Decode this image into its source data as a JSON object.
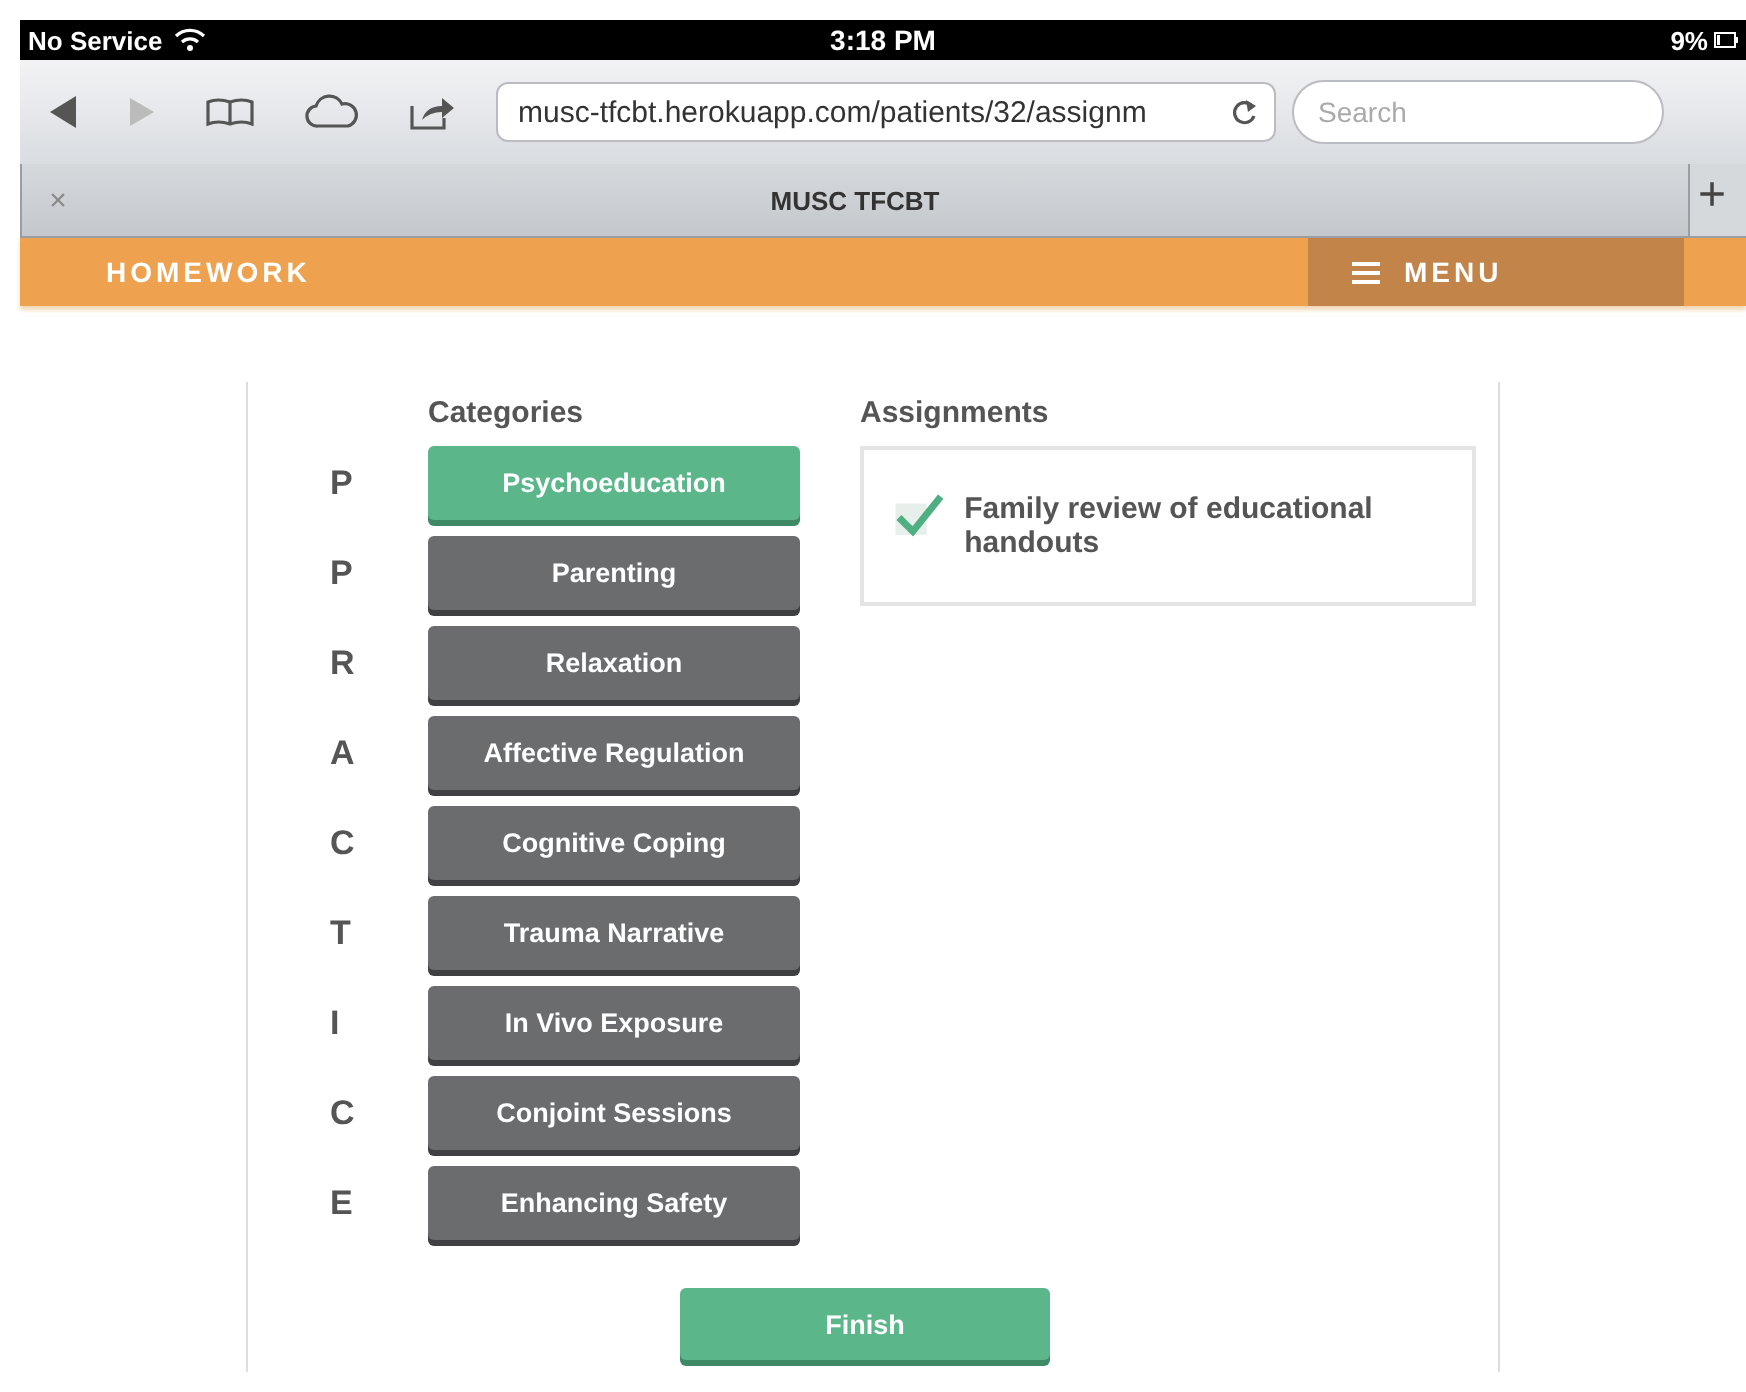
{
  "status_bar": {
    "carrier": "No Service",
    "time": "3:18 PM",
    "battery": "9%"
  },
  "browser": {
    "url": "musc-tfcbt.herokuapp.com/patients/32/assignm",
    "search": {
      "placeholder": "Search"
    },
    "tab": {
      "title": "MUSC TFCBT",
      "close": "×"
    },
    "new_tab": "+"
  },
  "app_bar": {
    "title": "HOMEWORK",
    "menu": "MENU"
  },
  "categories_heading": "Categories",
  "categories": [
    {
      "letter": "P",
      "label": "Psychoeducation",
      "selected": true
    },
    {
      "letter": "P",
      "label": "Parenting",
      "selected": false
    },
    {
      "letter": "R",
      "label": "Relaxation",
      "selected": false
    },
    {
      "letter": "A",
      "label": "Affective Regulation",
      "selected": false
    },
    {
      "letter": "C",
      "label": "Cognitive Coping",
      "selected": false
    },
    {
      "letter": "T",
      "label": "Trauma Narrative",
      "selected": false
    },
    {
      "letter": "I",
      "label": "In Vivo Exposure",
      "selected": false
    },
    {
      "letter": "C",
      "label": "Conjoint Sessions",
      "selected": false
    },
    {
      "letter": "E",
      "label": "Enhancing Safety",
      "selected": false
    }
  ],
  "assignments_heading": "Assignments",
  "assignments": [
    {
      "label": "Family review of educational handouts",
      "checked": true
    }
  ],
  "finish_button": "Finish"
}
